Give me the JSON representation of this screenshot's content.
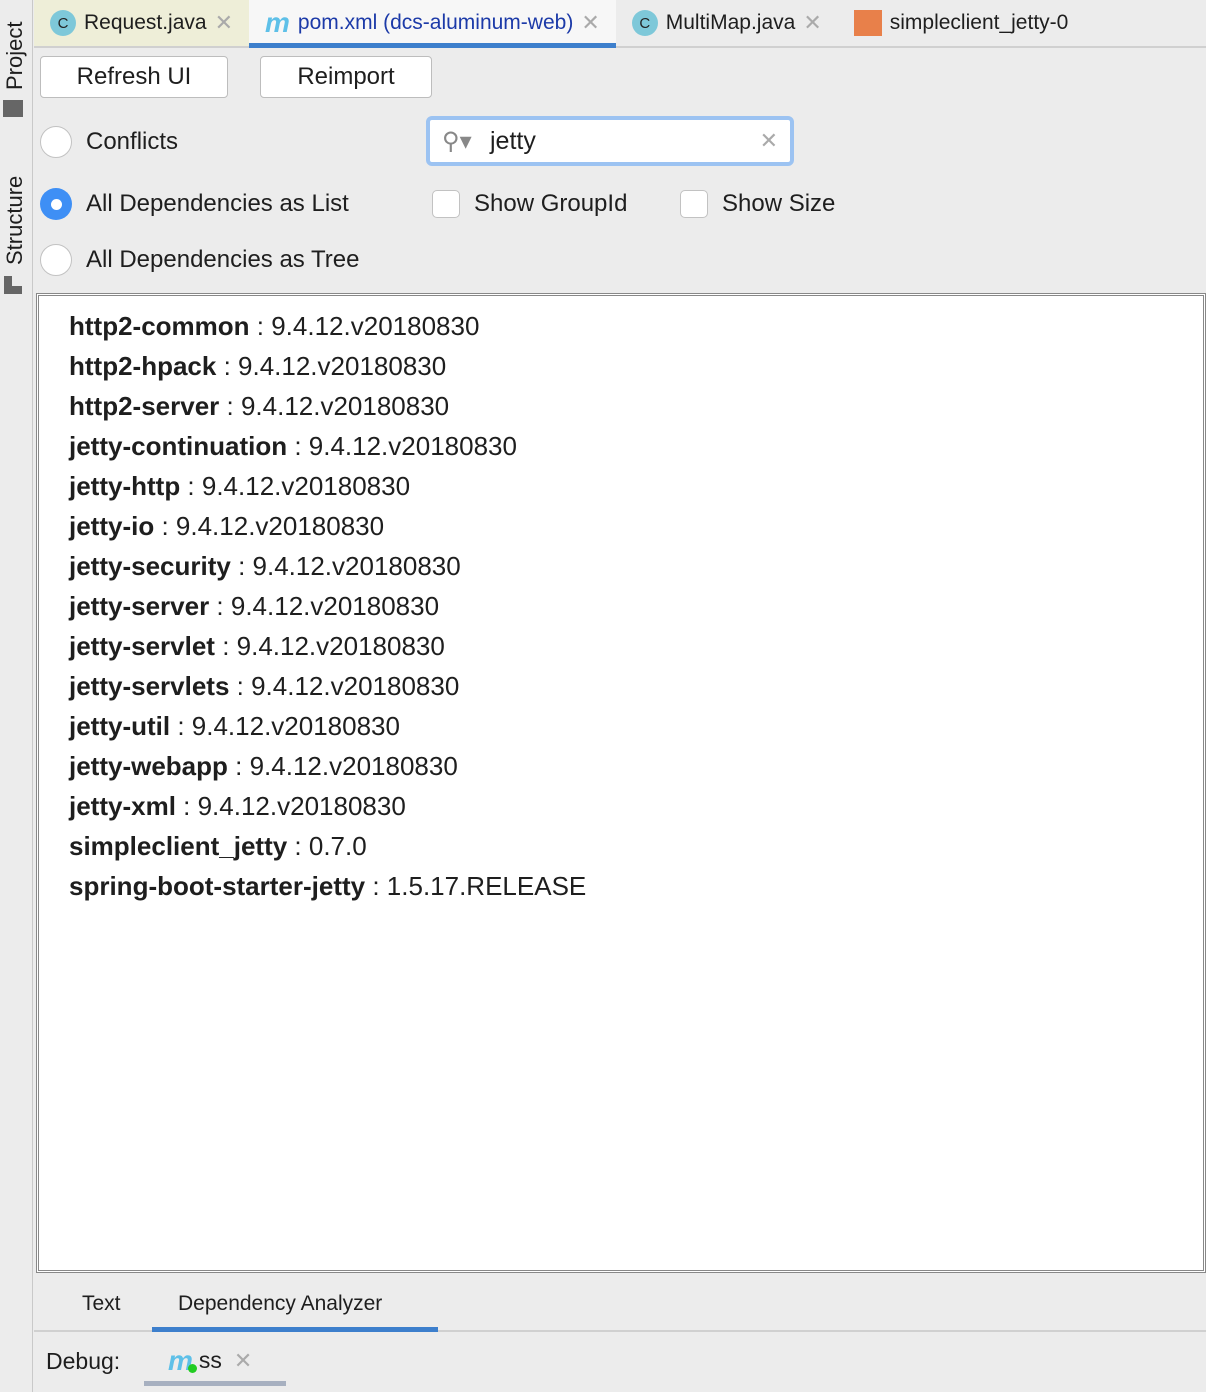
{
  "sidebar": {
    "project": "Project",
    "structure": "Structure"
  },
  "tabs": [
    {
      "label": "Request.java",
      "icon": "C"
    },
    {
      "label": "pom.xml (dcs-aluminum-web)",
      "icon": "m"
    },
    {
      "label": "MultiMap.java",
      "icon": "C"
    },
    {
      "label": "simpleclient_jetty-0"
    }
  ],
  "toolbar": {
    "refresh": "Refresh UI",
    "reimport": "Reimport"
  },
  "options": {
    "conflicts": "Conflicts",
    "list": "All Dependencies as List",
    "tree": "All Dependencies as Tree",
    "show_groupid": "Show GroupId",
    "show_size": "Show Size"
  },
  "search": {
    "value": "jetty"
  },
  "dependencies": [
    {
      "name": "http2-common",
      "version": "9.4.12.v20180830"
    },
    {
      "name": "http2-hpack",
      "version": "9.4.12.v20180830"
    },
    {
      "name": "http2-server",
      "version": "9.4.12.v20180830"
    },
    {
      "name": "jetty-continuation",
      "version": "9.4.12.v20180830"
    },
    {
      "name": "jetty-http",
      "version": "9.4.12.v20180830"
    },
    {
      "name": "jetty-io",
      "version": "9.4.12.v20180830"
    },
    {
      "name": "jetty-security",
      "version": "9.4.12.v20180830"
    },
    {
      "name": "jetty-server",
      "version": "9.4.12.v20180830"
    },
    {
      "name": "jetty-servlet",
      "version": "9.4.12.v20180830"
    },
    {
      "name": "jetty-servlets",
      "version": "9.4.12.v20180830"
    },
    {
      "name": "jetty-util",
      "version": "9.4.12.v20180830"
    },
    {
      "name": "jetty-webapp",
      "version": "9.4.12.v20180830"
    },
    {
      "name": "jetty-xml",
      "version": "9.4.12.v20180830"
    },
    {
      "name": "simpleclient_jetty",
      "version": "0.7.0"
    },
    {
      "name": "spring-boot-starter-jetty",
      "version": "1.5.17.RELEASE"
    }
  ],
  "bottom_tabs": {
    "text": "Text",
    "analyzer": "Dependency Analyzer"
  },
  "debug": {
    "label": "Debug:",
    "session": "ss"
  }
}
